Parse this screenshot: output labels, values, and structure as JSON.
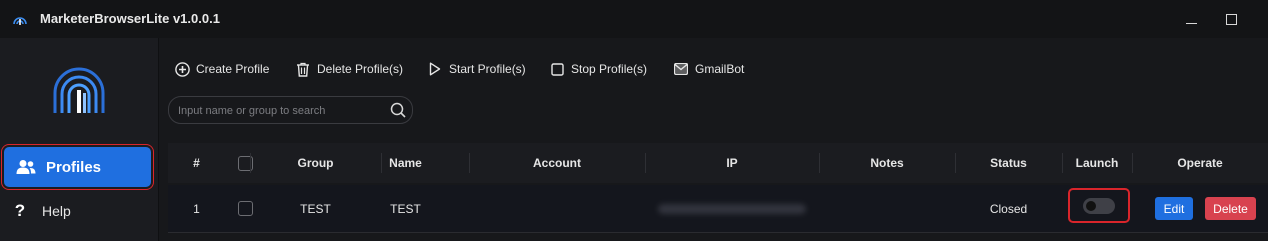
{
  "window": {
    "title": "MarketerBrowserLite v1.0.0.1"
  },
  "sidebar": {
    "items": [
      {
        "label": "Profiles",
        "icon": "users-icon",
        "active": true
      },
      {
        "label": "Help",
        "icon": "question-icon",
        "active": false
      }
    ]
  },
  "toolbar": {
    "create_label": "Create Profile",
    "delete_label": "Delete Profile(s)",
    "start_label": "Start Profile(s)",
    "stop_label": "Stop Profile(s)",
    "gmailbot_label": "GmailBot"
  },
  "search": {
    "placeholder": "Input name or group to search"
  },
  "table": {
    "columns": [
      "#",
      "",
      "Group",
      "Name",
      "Account",
      "IP",
      "Notes",
      "Status",
      "Launch",
      "Operate"
    ],
    "rows": [
      {
        "index": "1",
        "group": "TEST",
        "name": "TEST",
        "account": "",
        "ip": "",
        "notes": "",
        "status": "Closed",
        "launch_on": false,
        "edit_label": "Edit",
        "delete_label": "Delete"
      }
    ]
  },
  "colors": {
    "accent": "#1f6fe0",
    "danger": "#d8424f",
    "highlight_border": "#d9252b",
    "background": "#17181b"
  }
}
